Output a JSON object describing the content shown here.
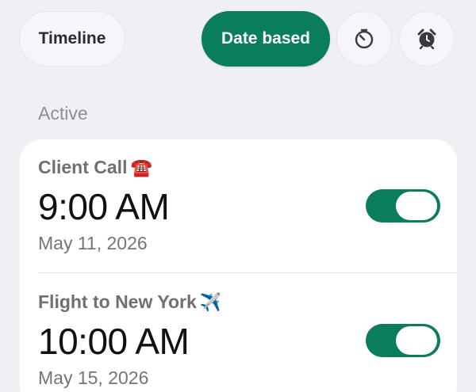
{
  "header": {
    "tabs": [
      {
        "label": "Timeline",
        "active": false
      },
      {
        "label": "Date based",
        "active": true
      }
    ],
    "icons": [
      "timer-icon",
      "alarm-clock-icon"
    ]
  },
  "section": {
    "label": "Active"
  },
  "alarms": [
    {
      "title": "Client Call",
      "emoji": "☎️",
      "time": "9:00 AM",
      "date": "May 11, 2026",
      "enabled": true
    },
    {
      "title": "Flight to New York",
      "emoji": "✈️",
      "time": "10:00 AM",
      "date": "May 15, 2026",
      "enabled": true
    }
  ],
  "colors": {
    "accent": "#0a7d5d",
    "background": "#f0eff4",
    "card": "#ffffff"
  }
}
